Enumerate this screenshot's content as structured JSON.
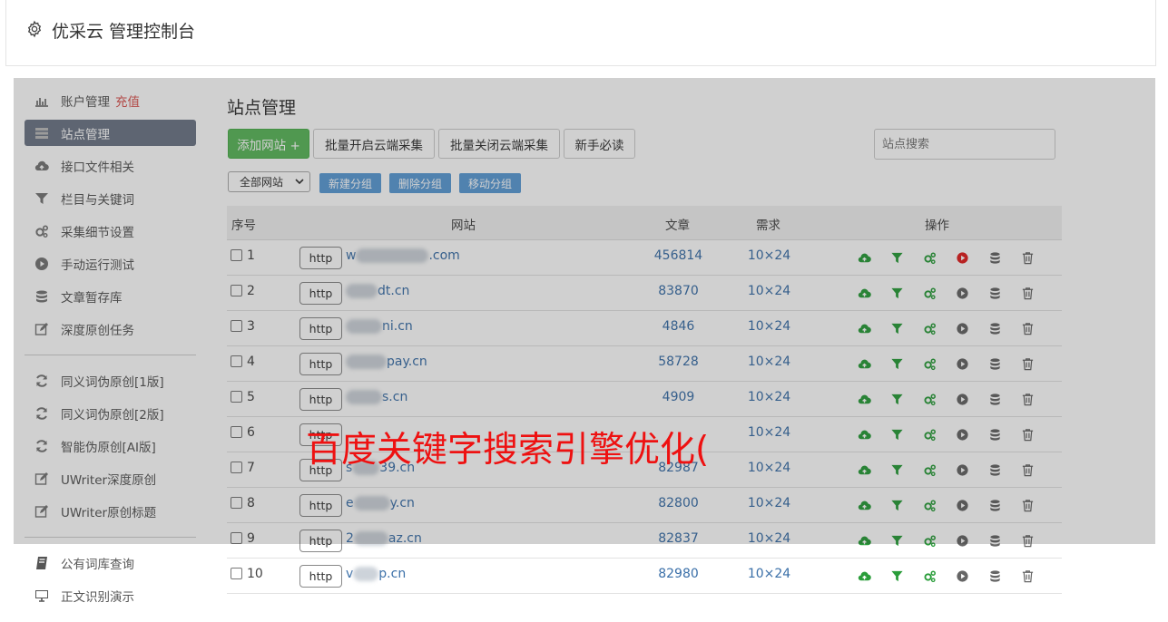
{
  "header": {
    "title": "优采云 管理控制台"
  },
  "sidebar": {
    "items": [
      {
        "label": "账户管理",
        "badge": "充值",
        "icon": "bar-chart-icon"
      },
      {
        "label": "站点管理",
        "icon": "server-icon",
        "active": true
      },
      {
        "label": "接口文件相关",
        "icon": "cloud-upload-icon"
      },
      {
        "label": "栏目与关键词",
        "icon": "filter-icon"
      },
      {
        "label": "采集细节设置",
        "icon": "gears-icon"
      },
      {
        "label": "手动运行测试",
        "icon": "play-circle-icon"
      },
      {
        "label": "文章暂存库",
        "icon": "database-icon"
      },
      {
        "label": "深度原创任务",
        "icon": "edit-icon"
      }
    ],
    "items2": [
      {
        "label": "同义词伪原创[1版]",
        "icon": "refresh-icon"
      },
      {
        "label": "同义词伪原创[2版]",
        "icon": "refresh-icon"
      },
      {
        "label": "智能伪原创[AI版]",
        "icon": "refresh-icon"
      },
      {
        "label": "UWriter深度原创",
        "icon": "edit-icon"
      },
      {
        "label": "UWriter原创标题",
        "icon": "edit-icon"
      }
    ],
    "items3": [
      {
        "label": "公有词库查询",
        "icon": "book-icon"
      },
      {
        "label": "正文识别演示",
        "icon": "monitor-icon"
      }
    ]
  },
  "main": {
    "title": "站点管理",
    "add_button": "添加网站 +",
    "batch_on": "批量开启云端采集",
    "batch_off": "批量关闭云端采集",
    "guide": "新手必读",
    "search_placeholder": "站点搜索",
    "group_select": "全部网站",
    "new_group": "新建分组",
    "delete_group": "删除分组",
    "move_group": "移动分组"
  },
  "table": {
    "headers": {
      "index": "序号",
      "site": "网站",
      "articles": "文章",
      "demand": "需求",
      "actions": "操作"
    },
    "rows": [
      {
        "num": "1",
        "proto": "http",
        "prefix": "w",
        "suffix": ".com",
        "articles": "456814",
        "demand": "10×24",
        "run_red": true
      },
      {
        "num": "2",
        "proto": "http",
        "prefix": "",
        "suffix": "dt.cn",
        "articles": "83870",
        "demand": "10×24"
      },
      {
        "num": "3",
        "proto": "http",
        "prefix": "",
        "suffix": "ni.cn",
        "articles": "4846",
        "demand": "10×24"
      },
      {
        "num": "4",
        "proto": "http",
        "prefix": "",
        "suffix": "pay.cn",
        "articles": "58728",
        "demand": "10×24"
      },
      {
        "num": "5",
        "proto": "http",
        "prefix": "",
        "suffix": "s.cn",
        "articles": "4909",
        "demand": "10×24"
      },
      {
        "num": "6",
        "proto": "http",
        "prefix": "",
        "suffix": "",
        "articles": "",
        "demand": "10×24"
      },
      {
        "num": "7",
        "proto": "http",
        "prefix": "s",
        "suffix": "39.cn",
        "articles": "82987",
        "demand": "10×24"
      },
      {
        "num": "8",
        "proto": "http",
        "prefix": "e",
        "suffix": "y.cn",
        "articles": "82800",
        "demand": "10×24"
      },
      {
        "num": "9",
        "proto": "http",
        "prefix": "2",
        "suffix": "az.cn",
        "articles": "82837",
        "demand": "10×24"
      },
      {
        "num": "10",
        "proto": "http",
        "prefix": "v",
        "suffix": "p.cn",
        "articles": "82980",
        "demand": "10×24"
      }
    ]
  },
  "watermark": "百度关键字搜索引擎优化(",
  "colors": {
    "green": "#5cb85c",
    "blue_link": "#3a6fa8",
    "small_btn": "#5b9bd5",
    "active_nav": "#6e7787",
    "red": "#e02020"
  }
}
